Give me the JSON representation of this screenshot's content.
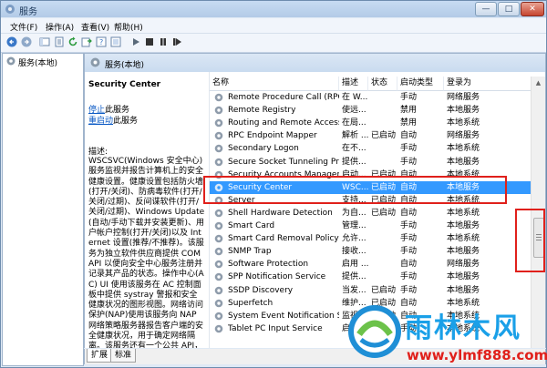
{
  "window": {
    "title": "服务",
    "minimize": "—",
    "maximize": "□",
    "close": "✕"
  },
  "menu": [
    "文件(F)",
    "操作(A)",
    "查看(V)",
    "帮助(H)"
  ],
  "tree": {
    "root_label": "服务(本地)"
  },
  "panel": {
    "header_label": "服务(本地)"
  },
  "description": {
    "service_title": "Security Center",
    "stop_link": "停止",
    "stop_suffix": "此服务",
    "restart_link": "重启动",
    "restart_suffix": "此服务",
    "label": "描述:",
    "text": "WSCSVC(Windows 安全中心)服务监视并报告计算机上的安全健康设置。健康设置包括防火墙(打开/关闭)、防病毒软件(打开/关闭/过期)、反间谍软件(打开/关闭/过期)、Windows Update(自动/手动下载并安装更新)、用户帐户控制(打开/关闭)以及 Internet 设置(推荐/不推荐)。该服务为独立软件供应商提供 COM API 以便向安全中心服务注册并记录其产品的状态。操作中心(AC) UI 使用该服务在 AC 控制面板中提供 systray 警报和安全健康状况的图形视图。网络访问保护(NAP)使用该服务向 NAP 网络策略服务器报告客户端的安全健康状况，用于确定网络隔离。该服务还有一个公共 API，该"
  },
  "columns": [
    "名称",
    "描述",
    "状态",
    "启动类型",
    "登录为"
  ],
  "services": [
    {
      "name": "Remote Procedure Call (RPC) ...",
      "desc": "在 W...",
      "status": "",
      "startup": "手动",
      "logon": "网络服务"
    },
    {
      "name": "Remote Registry",
      "desc": "使远...",
      "status": "",
      "startup": "禁用",
      "logon": "本地服务"
    },
    {
      "name": "Routing and Remote Access",
      "desc": "在局...",
      "status": "",
      "startup": "禁用",
      "logon": "本地系统"
    },
    {
      "name": "RPC Endpoint Mapper",
      "desc": "解析 ...",
      "status": "已启动",
      "startup": "自动",
      "logon": "网络服务"
    },
    {
      "name": "Secondary Logon",
      "desc": "在不...",
      "status": "",
      "startup": "手动",
      "logon": "本地系统"
    },
    {
      "name": "Secure Socket Tunneling Prot...",
      "desc": "提供...",
      "status": "",
      "startup": "手动",
      "logon": "本地服务"
    },
    {
      "name": "Security Accounts Manager",
      "desc": "启动...",
      "status": "已启动",
      "startup": "自动",
      "logon": "本地系统"
    },
    {
      "name": "Security Center",
      "desc": "WSC...",
      "status": "已启动",
      "startup": "自动",
      "logon": "本地服务"
    },
    {
      "name": "Server",
      "desc": "支持...",
      "status": "已启动",
      "startup": "自动",
      "logon": "本地系统"
    },
    {
      "name": "Shell Hardware Detection",
      "desc": "为自...",
      "status": "已启动",
      "startup": "自动",
      "logon": "本地系统"
    },
    {
      "name": "Smart Card",
      "desc": "管理...",
      "status": "",
      "startup": "手动",
      "logon": "本地服务"
    },
    {
      "name": "Smart Card Removal Policy",
      "desc": "允许...",
      "status": "",
      "startup": "手动",
      "logon": "本地系统"
    },
    {
      "name": "SNMP Trap",
      "desc": "接收...",
      "status": "",
      "startup": "手动",
      "logon": "本地服务"
    },
    {
      "name": "Software Protection",
      "desc": "启用 ...",
      "status": "",
      "startup": "自动",
      "logon": "网络服务"
    },
    {
      "name": "SPP Notification Service",
      "desc": "提供...",
      "status": "",
      "startup": "手动",
      "logon": "本地服务"
    },
    {
      "name": "SSDP Discovery",
      "desc": "当发...",
      "status": "已启动",
      "startup": "手动",
      "logon": "本地服务"
    },
    {
      "name": "Superfetch",
      "desc": "维护...",
      "status": "已启动",
      "startup": "自动",
      "logon": "本地系统"
    },
    {
      "name": "System Event Notification Serv...",
      "desc": "监视...",
      "status": "已启动",
      "startup": "自动",
      "logon": "本地系统"
    },
    {
      "name": "Tablet PC Input Service",
      "desc": "启用 ...",
      "status": "",
      "startup": "手动",
      "logon": "本地系统"
    }
  ],
  "tabs": [
    "扩展",
    "标准"
  ],
  "watermark": {
    "title": "雨林木风",
    "url": "www.ylmf888.com"
  },
  "colors": {
    "selection": "#3399ff",
    "highlight_box": "#e0201b",
    "link": "#0a59c4"
  }
}
